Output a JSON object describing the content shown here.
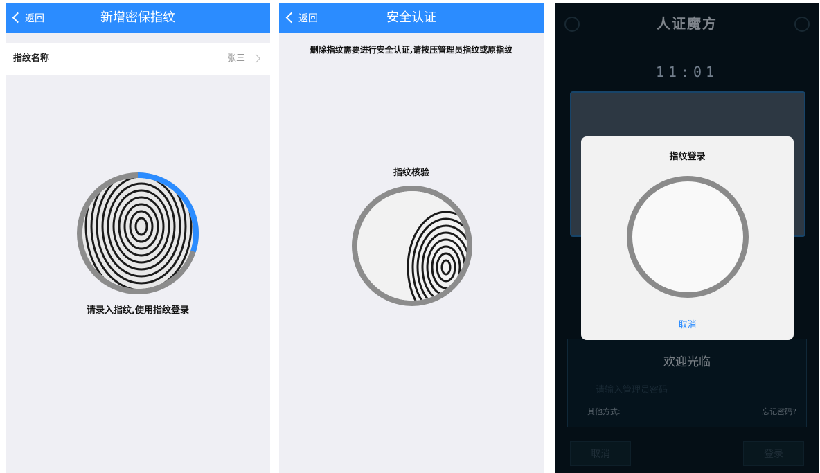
{
  "panel1": {
    "back_label": "返回",
    "title": "新增密保指纹",
    "row_label": "指纹名称",
    "row_value": "张三",
    "caption": "请录入指纹,使用指纹登录",
    "progress_fraction": 0.3,
    "accent": "#2b8cff"
  },
  "panel2": {
    "back_label": "返回",
    "title": "安全认证",
    "instruction": "删除指纹需要进行安全认证,请按压管理员指纹或原指纹",
    "check_label": "指纹核验"
  },
  "panel3": {
    "app_title": "人证魔方",
    "time": "11:01",
    "dialog_title": "指纹登录",
    "dialog_cancel": "取消",
    "welcome": "欢迎光临",
    "password_placeholder": "请输入管理员密码",
    "other_methods": "其他方式:",
    "forgot": "忘记密码?",
    "cancel_button": "取消",
    "login_button": "登录"
  }
}
